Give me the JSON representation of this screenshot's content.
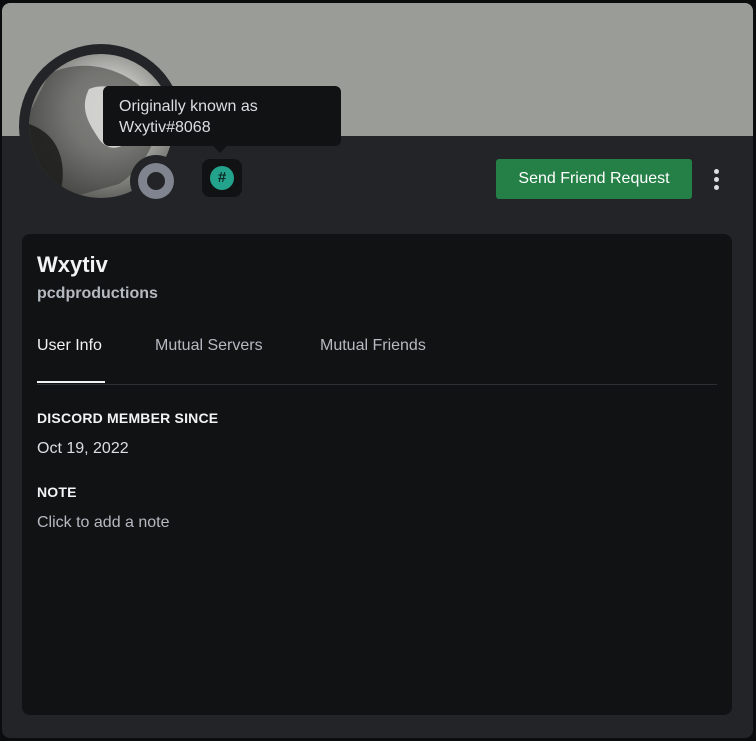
{
  "tooltip": {
    "line1": "Originally known as",
    "line2": "Wxytiv#8068"
  },
  "badge": {
    "icon": "hashtag-badge-icon",
    "glyph": "#"
  },
  "actions": {
    "friend_request_label": "Send Friend Request",
    "more_icon": "more-vertical-icon"
  },
  "profile": {
    "display_name": "Wxytiv",
    "username": "pcdproductions",
    "status": "offline"
  },
  "tabs": [
    {
      "label": "User Info",
      "active": true
    },
    {
      "label": "Mutual Servers",
      "active": false
    },
    {
      "label": "Mutual Friends",
      "active": false
    }
  ],
  "info": {
    "member_since_title": "DISCORD MEMBER SINCE",
    "member_since_value": "Oct 19, 2022",
    "note_title": "NOTE",
    "note_placeholder": "Click to add a note"
  },
  "colors": {
    "banner": "#9a9c98",
    "accent_green": "#248046",
    "badge_teal": "#23a38c",
    "status_offline": "#80848e"
  }
}
